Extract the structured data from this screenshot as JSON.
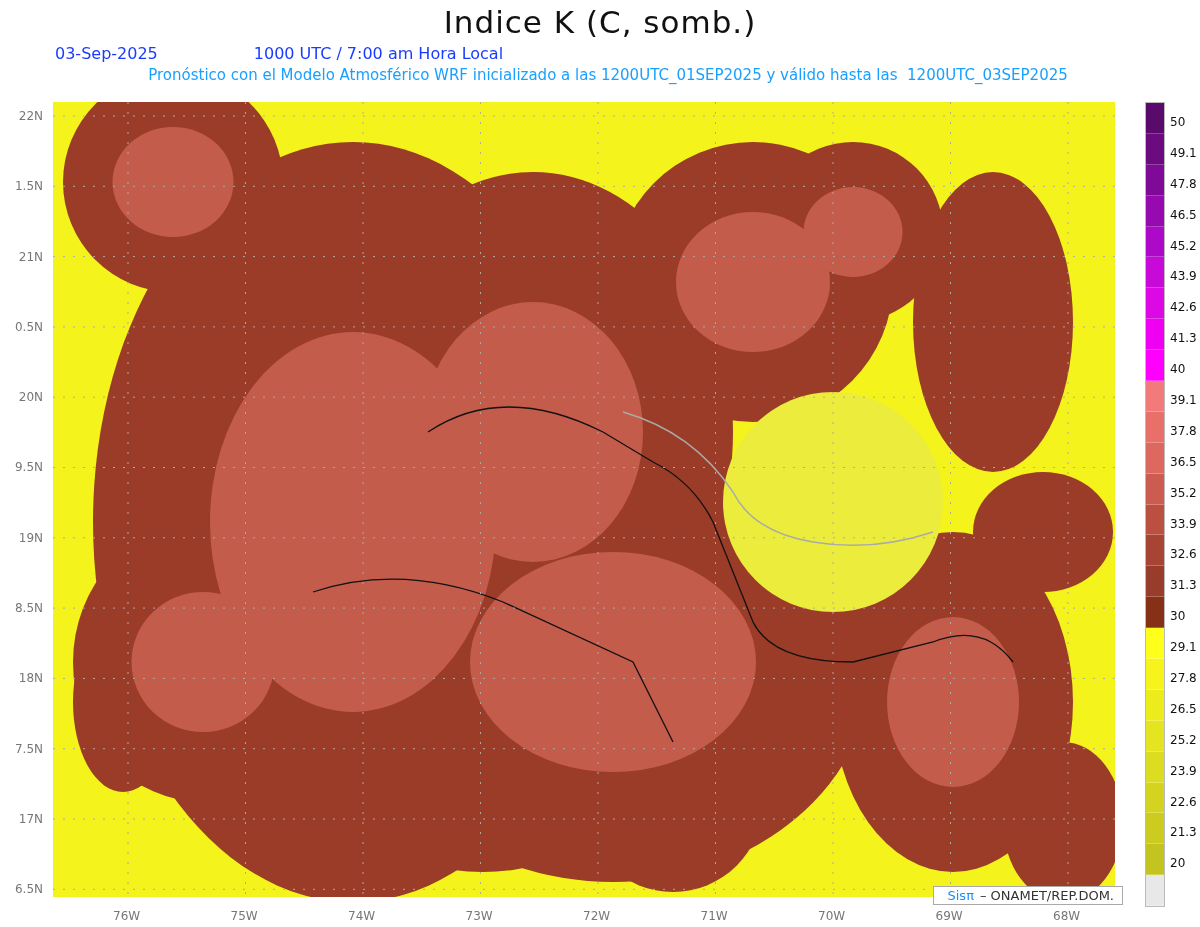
{
  "title": "Indice K (C, somb.)",
  "date": "03-Sep-2025",
  "time": "1000 UTC / 7:00 am Hora Local",
  "subtitle": "Pronóstico con el Modelo Atmosférico WRF inicializado a las 1200UTC_01SEP2025 y válido hasta las  1200UTC_03SEP2025",
  "lat_ticks": [
    "22N",
    "1.5N",
    "21N",
    "0.5N",
    "20N",
    "9.5N",
    "19N",
    "8.5N",
    "18N",
    "7.5N",
    "17N",
    "6.5N"
  ],
  "lon_ticks": [
    "76W",
    "75W",
    "74W",
    "73W",
    "72W",
    "71W",
    "70W",
    "69W",
    "68W"
  ],
  "colorbar": {
    "swatches": [
      {
        "color": "#5a0a6a"
      },
      {
        "color": "#6c0a80"
      },
      {
        "color": "#800a98"
      },
      {
        "color": "#960ab0"
      },
      {
        "color": "#ac0ac8"
      },
      {
        "color": "#c80ad8"
      },
      {
        "color": "#dc08e6"
      },
      {
        "color": "#f000f2"
      },
      {
        "color": "#ff00ff"
      },
      {
        "color": "#f27a7a"
      },
      {
        "color": "#e87068"
      },
      {
        "color": "#dc6860"
      },
      {
        "color": "#cc5c50"
      },
      {
        "color": "#bc5040"
      },
      {
        "color": "#a84434"
      },
      {
        "color": "#983c2c"
      },
      {
        "color": "#863018"
      },
      {
        "color": "#ffff1c"
      },
      {
        "color": "#f6f41c"
      },
      {
        "color": "#ecec1c"
      },
      {
        "color": "#e4e420"
      },
      {
        "color": "#dcdc20"
      },
      {
        "color": "#d4d420"
      },
      {
        "color": "#cccc20"
      },
      {
        "color": "#c4c420"
      },
      {
        "color": "#e8e8e8"
      }
    ],
    "labels": [
      "50",
      "49.1",
      "47.8",
      "46.5",
      "45.2",
      "43.9",
      "42.6",
      "41.3",
      "40",
      "39.1",
      "37.8",
      "36.5",
      "35.2",
      "33.9",
      "32.6",
      "31.3",
      "30",
      "29.1",
      "27.8",
      "26.5",
      "25.2",
      "23.9",
      "22.6",
      "21.3",
      "20"
    ]
  },
  "credit": {
    "brand": "Sisπ",
    "text": "– ONAMET/REP.DOM."
  }
}
